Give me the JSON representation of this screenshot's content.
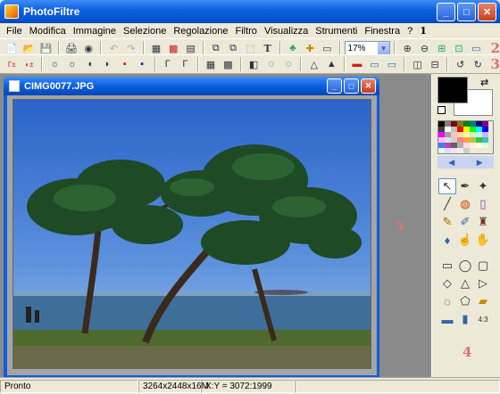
{
  "app": {
    "title": "PhotoFiltre"
  },
  "menu": [
    "File",
    "Modifica",
    "Immagine",
    "Selezione",
    "Regolazione",
    "Filtro",
    "Visualizza",
    "Strumenti",
    "Finestra",
    "?"
  ],
  "markers": {
    "m1": "1",
    "m2": "2",
    "m3": "3",
    "m4": "4",
    "m5": "5"
  },
  "toolbar": {
    "zoom_value": "17%"
  },
  "document": {
    "title": "CIMG0077.JPG"
  },
  "status": {
    "text": "Pronto",
    "dimensions": "3264x2448x16M",
    "coords": "X:Y = 3072:1999"
  },
  "colors": {
    "accent": "#0a5fe0",
    "foreground": "#000000",
    "background": "#ffffff",
    "marker": "#e07070"
  },
  "icons": {
    "toolbar1": [
      "new-icon",
      "open-icon",
      "save-icon",
      "print-icon",
      "scan-icon",
      "undo-icon",
      "redo-icon",
      "grayscale-icon",
      "rgb-icon",
      "fx-icon",
      "copy-icon",
      "paste-icon",
      "crop-icon",
      "text-icon",
      "tree-icon",
      "puzzle-icon",
      "window-icon",
      "zoom-in-icon",
      "zoom-out-icon",
      "fit-icon",
      "fullscreen-icon",
      "monitor-icon"
    ],
    "tools": [
      "select-arrow-icon",
      "eyedropper-icon",
      "magic-wand-icon",
      "line-icon",
      "fill-icon",
      "spray-icon",
      "brush-icon",
      "smudge-brush-icon",
      "stamp-icon",
      "drop-icon",
      "finger-icon",
      "hand-icon"
    ]
  }
}
